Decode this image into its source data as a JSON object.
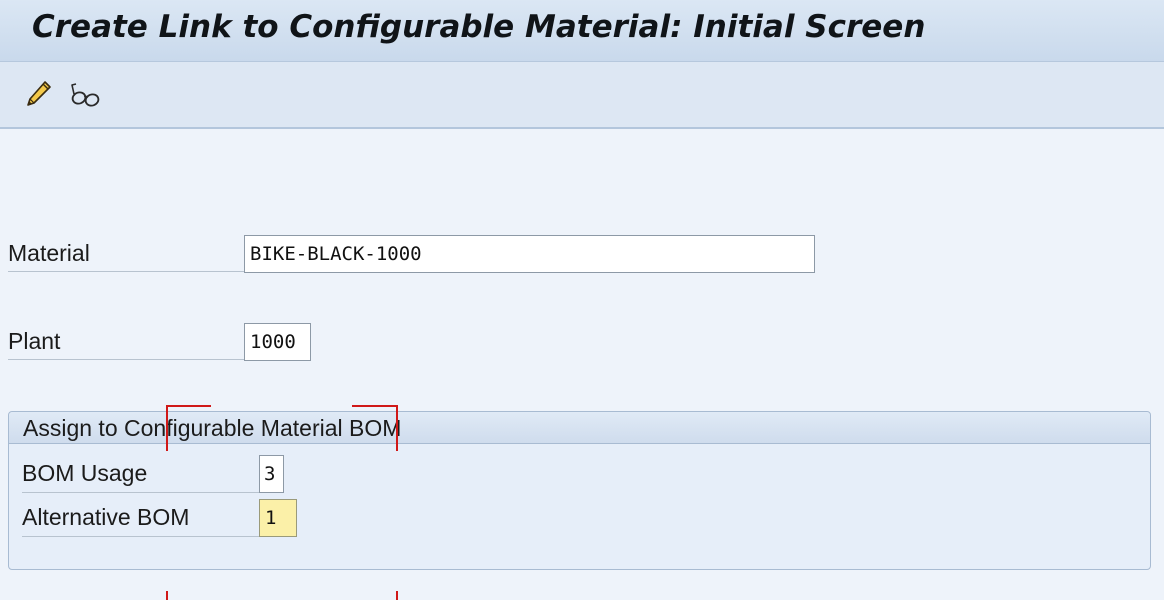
{
  "header": {
    "title": "Create Link to Configurable Material: Initial Screen"
  },
  "toolbar": {
    "buttons": [
      {
        "icon": "pencil-icon",
        "action": "change"
      },
      {
        "icon": "glasses-icon",
        "action": "display"
      }
    ]
  },
  "form": {
    "material": {
      "label": "Material",
      "value": "BIKE-BLACK-1000"
    },
    "plant": {
      "label": "Plant",
      "value": "1000"
    }
  },
  "group": {
    "title": "Assign to Configurable Material BOM",
    "bom_usage": {
      "label": "BOM Usage",
      "value": "3"
    },
    "alternative_bom": {
      "label": "Alternative BOM",
      "value": "1"
    }
  },
  "colors": {
    "highlight_field": "#fbf0a8",
    "annotation": "#d01818"
  }
}
